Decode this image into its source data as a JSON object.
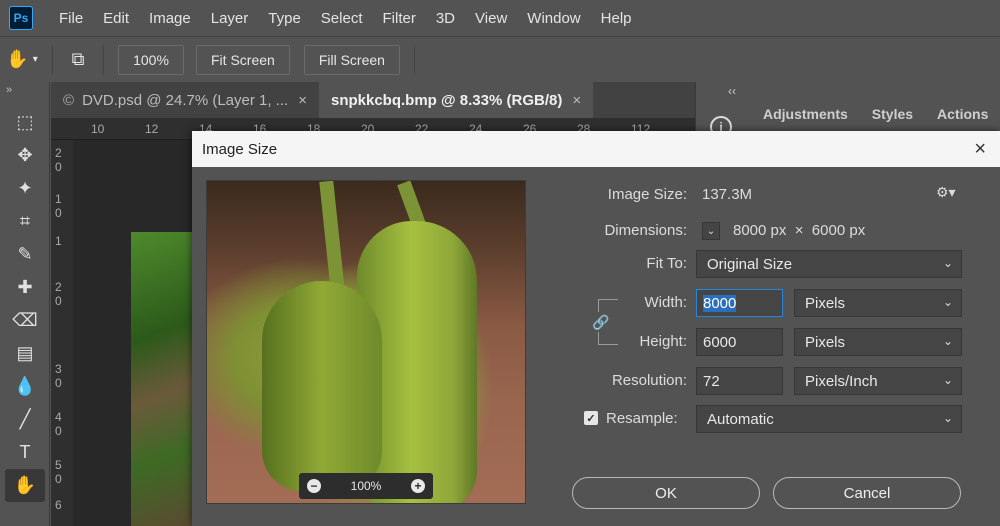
{
  "app": {
    "logo_text": "Ps"
  },
  "menu": [
    "File",
    "Edit",
    "Image",
    "Layer",
    "Type",
    "Select",
    "Filter",
    "3D",
    "View",
    "Window",
    "Help"
  ],
  "options_bar": {
    "zoom": "100%",
    "fit_screen": "Fit Screen",
    "fill_screen": "Fill Screen"
  },
  "toolbar": {
    "collapse": "»",
    "tools": [
      "marquee-icon",
      "move-icon",
      "magic-wand-icon",
      "crop-icon",
      "brush-icon",
      "healing-icon",
      "eraser-icon",
      "gradient-icon",
      "blur-icon",
      "line-icon",
      "type-icon",
      "hand-icon"
    ]
  },
  "tabs": [
    {
      "label": "DVD.psd @ 24.7% (Layer 1, ...",
      "close": "×",
      "active": false
    },
    {
      "label": "snpkkcbq.bmp @ 8.33% (RGB/8)",
      "close": "×",
      "active": true
    }
  ],
  "ruler": {
    "top_ticks": [
      "10",
      "12",
      "14",
      "16",
      "18",
      "20",
      "22",
      "24",
      "26",
      "28",
      "1",
      "112"
    ],
    "left_ticks": [
      "2",
      "0",
      "1",
      "0",
      "1",
      "2",
      "0",
      "3",
      "0",
      "4",
      "0",
      "5",
      "0",
      "6"
    ]
  },
  "right_panel": {
    "collapse": "‹‹",
    "tabs": [
      "Adjustments",
      "Styles",
      "Actions"
    ]
  },
  "dialog": {
    "title": "Image Size",
    "close": "×",
    "image_size_label": "Image Size:",
    "image_size_value": "137.3M",
    "gear": "⚙▾",
    "dimensions_label": "Dimensions:",
    "dimensions_value": "8000 px  ×  6000 px",
    "fit_to_label": "Fit To:",
    "fit_to_value": "Original Size",
    "width_label": "Width:",
    "width_value": "8000",
    "width_unit": "Pixels",
    "height_label": "Height:",
    "height_value": "6000",
    "height_unit": "Pixels",
    "resolution_label": "Resolution:",
    "resolution_value": "72",
    "resolution_unit": "Pixels/Inch",
    "resample_label": "Resample:",
    "resample_value": "Automatic",
    "resample_checked": true,
    "preview_zoom": "100%",
    "ok": "OK",
    "cancel": "Cancel"
  }
}
